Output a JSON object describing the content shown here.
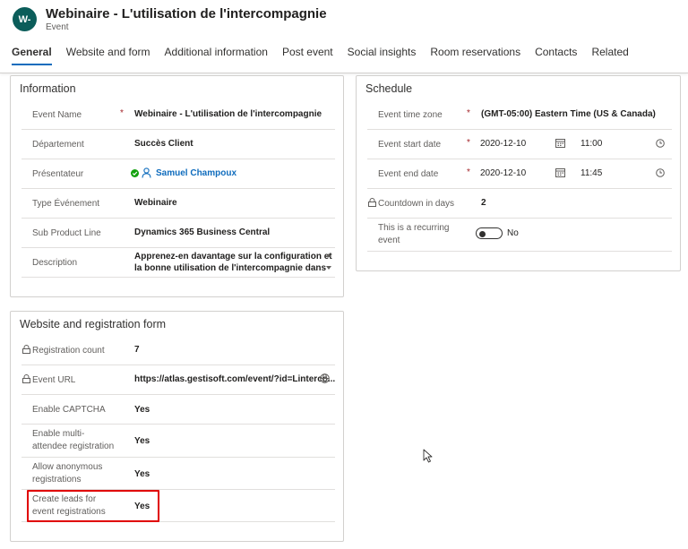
{
  "header": {
    "avatar_initials": "W-",
    "title": "Webinaire - L'utilisation de l'intercompagnie",
    "entity": "Event"
  },
  "tabs": [
    {
      "label": "General",
      "active": true
    },
    {
      "label": "Website and form"
    },
    {
      "label": "Additional information"
    },
    {
      "label": "Post event"
    },
    {
      "label": "Social insights"
    },
    {
      "label": "Room reservations"
    },
    {
      "label": "Contacts"
    },
    {
      "label": "Related"
    }
  ],
  "information": {
    "title": "Information",
    "event_name_label": "Event Name",
    "event_name_value": "Webinaire - L'utilisation de l'intercompagnie",
    "department_label": "Département",
    "department_value": "Succès Client",
    "presenter_label": "Présentateur",
    "presenter_value": "Samuel Champoux",
    "event_type_label": "Type Événement",
    "event_type_value": "Webinaire",
    "sub_product_label": "Sub Product Line",
    "sub_product_value": "Dynamics 365 Business Central",
    "description_label": "Description",
    "description_value": "Apprenez-en davantage sur la configuration et la bonne utilisation de l'intercompagnie dans"
  },
  "schedule": {
    "title": "Schedule",
    "timezone_label": "Event time zone",
    "timezone_value": "(GMT-05:00) Eastern Time (US & Canada)",
    "start_label": "Event start date",
    "start_date": "2020-12-10",
    "start_time": "11:00",
    "end_label": "Event end date",
    "end_date": "2020-12-10",
    "end_time": "11:45",
    "countdown_label": "Countdown in days",
    "countdown_value": "2",
    "recurring_label_1": "This is a recurring",
    "recurring_label_2": "event",
    "recurring_value": "No"
  },
  "website": {
    "title": "Website and registration form",
    "reg_count_label": "Registration count",
    "reg_count_value": "7",
    "url_label": "Event URL",
    "url_value": "https://atlas.gestisoft.com/event/?id=Linterco...",
    "captcha_label": "Enable CAPTCHA",
    "captcha_value": "Yes",
    "multi_label_1": "Enable multi-",
    "multi_label_2": "attendee registration",
    "multi_value": "Yes",
    "anon_label_1": "Allow anonymous",
    "anon_label_2": "registrations",
    "anon_value": "Yes",
    "leads_label_1": "Create leads for",
    "leads_label_2": "event registrations",
    "leads_value": "Yes"
  },
  "colors": {
    "accent": "#0f6cbd",
    "avatar": "#0b5d5a",
    "required": "#a4262c",
    "highlight": "#e00000",
    "presence": "#13a10e"
  }
}
